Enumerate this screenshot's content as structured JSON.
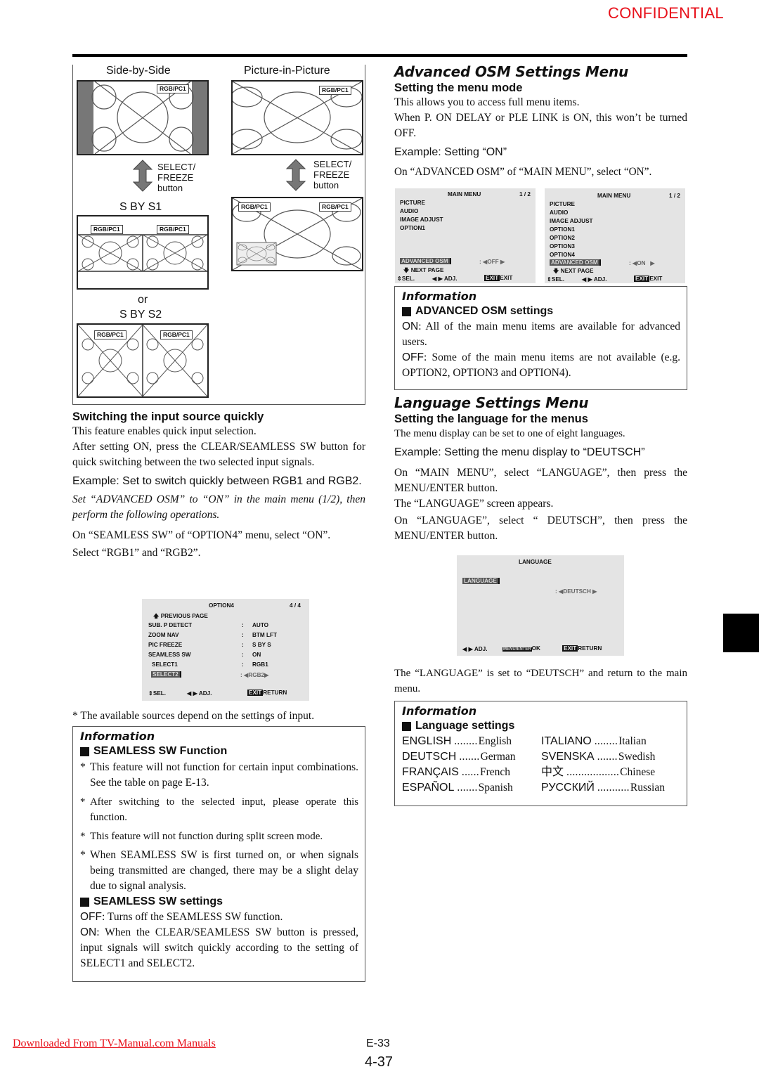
{
  "header": {
    "confidential": "CONFIDENTIAL"
  },
  "figure": {
    "side_by_side_label": "Side-by-Side",
    "pip_label": "Picture-in-Picture",
    "input_tag": "RGB/PC1",
    "select_freeze": [
      "SELECT/",
      "FREEZE",
      "button"
    ],
    "sbys1_label": "S BY S1",
    "or_label": "or",
    "sbys2_label": "S BY S2"
  },
  "left": {
    "switching_heading": "Switching the input source quickly",
    "switching_p1": "This feature enables quick input selection.",
    "switching_p2": "After setting ON, press the CLEAR/SEAMLESS SW button for quick switching between the two selected input signals.",
    "example": "Example: Set to switch quickly between RGB1 and RGB2.",
    "italic_note": "Set “ADVANCED OSM” to “ON” in the main menu (1/2), then perform the following operations.",
    "step1": "On “SEAMLESS SW” of “OPTION4” menu, select “ON”.",
    "step2": "Select “RGB1” and “RGB2”.",
    "footnote": "*  The available sources depend on the settings of input."
  },
  "option4_menu": {
    "title": "OPTION4",
    "page": "4 / 4",
    "prev": "PREVIOUS PAGE",
    "rows": [
      {
        "label": "SUB. P DETECT",
        "value": "AUTO"
      },
      {
        "label": "ZOOM NAV",
        "value": "BTM LFT"
      },
      {
        "label": "PIC FREEZE",
        "value": "S BY S"
      },
      {
        "label": "SEAMLESS SW",
        "value": "ON"
      },
      {
        "label": "SELECT1",
        "value": "RGB1"
      },
      {
        "label": "SELECT2",
        "value": "RGB2"
      }
    ],
    "sel": "SEL.",
    "adj": "ADJ.",
    "exit": "EXIT",
    "return": "RETURN"
  },
  "info_seamless": {
    "title": "Information",
    "func_heading": "SEAMLESS SW Function",
    "bullets": [
      "This feature will not function for certain input combinations. See the table on page E-13.",
      "After switching to the selected input, please operate this function.",
      "This feature will not function during split screen mode.",
      "When SEAMLESS SW is first turned on, or when signals being transmitted are changed, there may be a slight delay due to signal analysis."
    ],
    "settings_heading": "SEAMLESS SW settings",
    "off_key": "OFF",
    "off_text": ": Turns off the SEAMLESS SW function.",
    "on_key": "ON",
    "on_text": ": When the CLEAR/SEAMLESS SW button is pressed, input signals will switch quickly according to the setting of SELECT1 and SELECT2."
  },
  "advanced": {
    "heading": "Advanced OSM Settings Menu",
    "sub": "Setting the menu mode",
    "p1": "This allows you to access full menu items.",
    "p2": "When P. ON DELAY or PLE LINK is ON, this won’t be turned OFF.",
    "example": "Example: Setting “ON”",
    "step": "On “ADVANCED OSM” of “MAIN MENU”, select “ON”."
  },
  "main_menu_off": {
    "title": "MAIN MENU",
    "page": "1 / 2",
    "items": [
      "PICTURE",
      "AUDIO",
      "IMAGE ADJUST",
      "OPTION1"
    ],
    "adv_label": "ADVANCED OSM",
    "adv_value": "OFF",
    "next": "NEXT PAGE",
    "sel": "SEL.",
    "adj": "ADJ.",
    "exit_tag": "EXIT",
    "exit": "EXIT"
  },
  "main_menu_on": {
    "title": "MAIN MENU",
    "page": "1 / 2",
    "items": [
      "PICTURE",
      "AUDIO",
      "IMAGE ADJUST",
      "OPTION1",
      "OPTION2",
      "OPTION3",
      "OPTION4"
    ],
    "adv_label": "ADVANCED OSM",
    "adv_value": "ON",
    "next": "NEXT PAGE",
    "sel": "SEL.",
    "adj": "ADJ.",
    "exit_tag": "EXIT",
    "exit": "EXIT"
  },
  "info_advanced": {
    "title": "Information",
    "heading": "ADVANCED OSM settings",
    "on_key": "ON",
    "on_text": ": All of the main menu items are available for advanced users.",
    "off_key": "OFF",
    "off_text": ": Some of the main menu items are not available (e.g. OPTION2, OPTION3 and OPTION4)."
  },
  "language": {
    "heading": "Language Settings Menu",
    "sub": "Setting the language for the menus",
    "p1": "The menu display can be set to one of eight languages.",
    "example": "Example: Setting the menu display to “DEUTSCH”",
    "step1": "On “MAIN MENU”, select “LANGUAGE”, then press the MENU/ENTER button.",
    "step2": "The “LANGUAGE” screen appears.",
    "step3": "On “LANGUAGE”, select “ DEUTSCH”, then press the MENU/ENTER button.",
    "result": "The “LANGUAGE” is set to “DEUTSCH” and return to the main menu."
  },
  "language_menu": {
    "title": "LANGUAGE",
    "label": "LANGUAGE",
    "value": "DEUTSCH",
    "adj": "ADJ.",
    "menu_tag": "MENU/ENTER",
    "ok": "OK",
    "exit": "EXIT",
    "return": "RETURN"
  },
  "info_language": {
    "title": "Information",
    "heading": "Language settings",
    "left": [
      {
        "name": "ENGLISH",
        "dots": "........",
        "meaning": "English"
      },
      {
        "name": "DEUTSCH",
        "dots": ".......",
        "meaning": "German"
      },
      {
        "name": "FRANÇAIS",
        "dots": "......",
        "meaning": "French"
      },
      {
        "name": "ESPAÑOL",
        "dots": ".......",
        "meaning": "Spanish"
      }
    ],
    "right": [
      {
        "name": "ITALIANO",
        "dots": "........",
        "meaning": "Italian"
      },
      {
        "name": "SVENSKA",
        "dots": ".......",
        "meaning": "Swedish"
      },
      {
        "name": "中文",
        "dots": "..................",
        "meaning": "Chinese"
      },
      {
        "name": "РУССКИЙ",
        "dots": "...........",
        "meaning": "Russian"
      }
    ]
  },
  "footer": {
    "link": "Downloaded From TV-Manual.com Manuals",
    "page_e": "E-33",
    "page_num": "4-37"
  }
}
